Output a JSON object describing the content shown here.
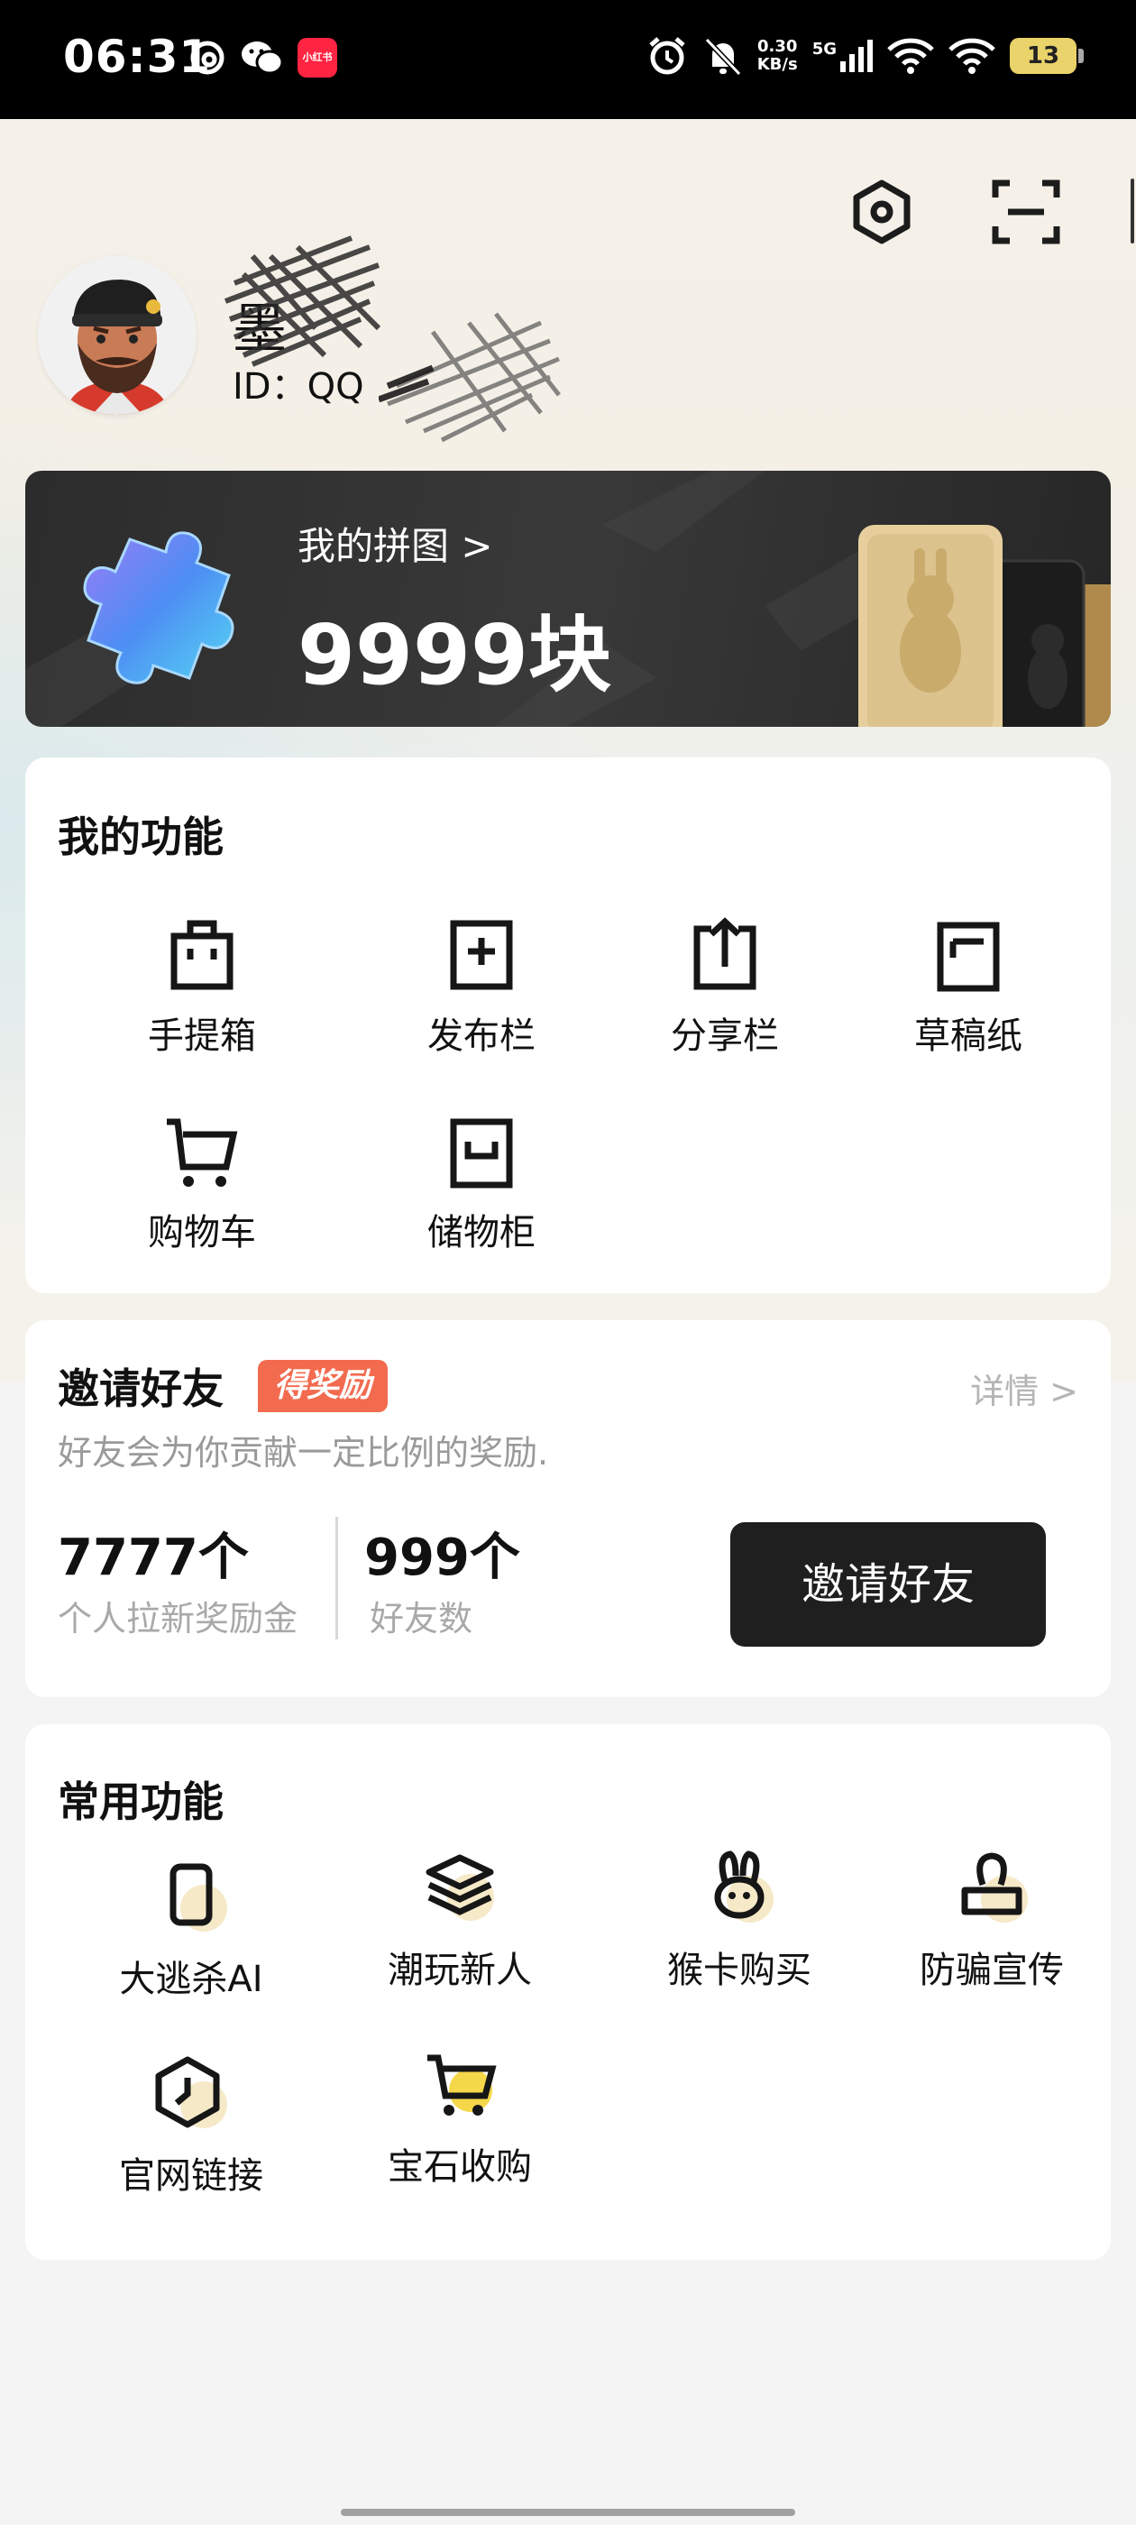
{
  "status_bar": {
    "time": "06:31",
    "app_icon_text": "小红书",
    "speed": "0.30",
    "speed_unit": "KB/s",
    "network": "5G",
    "battery": "13"
  },
  "header": {
    "username": "墨",
    "user_id": "ID：QQ"
  },
  "puzzle": {
    "link": "我的拼图 >",
    "count": "9999块"
  },
  "my_functions": {
    "title": "我的功能",
    "items": [
      {
        "label": "手提箱",
        "icon": "bag-icon"
      },
      {
        "label": "发布栏",
        "icon": "publish-icon"
      },
      {
        "label": "分享栏",
        "icon": "share-icon"
      },
      {
        "label": "草稿纸",
        "icon": "draft-icon"
      },
      {
        "label": "购物车",
        "icon": "cart-icon"
      },
      {
        "label": "储物柜",
        "icon": "locker-icon"
      }
    ]
  },
  "invite": {
    "title": "邀请好友",
    "badge": "得奖励",
    "detail": "详情 >",
    "description": "好友会为你贡献一定比例的奖励.",
    "reward_value": "7777个",
    "reward_label": "个人拉新奖励金",
    "friends_value": "999个",
    "friends_label": "好友数",
    "button": "邀请好友"
  },
  "common_functions": {
    "title": "常用功能",
    "items": [
      {
        "label": "大逃杀AI",
        "icon": "phone-icon"
      },
      {
        "label": "潮玩新人",
        "icon": "layers-icon"
      },
      {
        "label": "猴卡购买",
        "icon": "bunny-icon"
      },
      {
        "label": "防骗宣传",
        "icon": "stamp-icon"
      },
      {
        "label": "官网链接",
        "icon": "clock-hex-icon"
      },
      {
        "label": "宝石收购",
        "icon": "shopping-cart-icon"
      }
    ]
  },
  "colors": {
    "accent_badge": "#f26b4f",
    "button_dark": "#1f1f1f",
    "icon_highlight": "#f5e9c8"
  }
}
